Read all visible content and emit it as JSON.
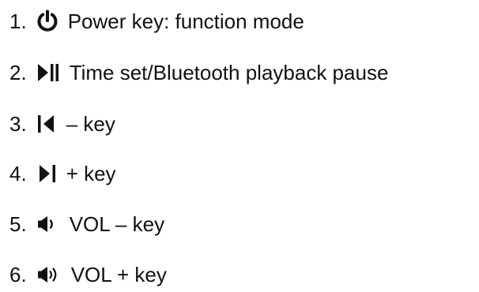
{
  "items": [
    {
      "number": "1.",
      "icon": "power-icon",
      "label": "Power key: function mode"
    },
    {
      "number": "2.",
      "icon": "play-pause-icon",
      "label": "Time set/Bluetooth playback pause"
    },
    {
      "number": "3.",
      "icon": "skip-previous-icon",
      "label": "– key"
    },
    {
      "number": "4.",
      "icon": "skip-next-icon",
      "label": "+ key"
    },
    {
      "number": "5.",
      "icon": "volume-low-icon",
      "label": "VOL – key"
    },
    {
      "number": "6.",
      "icon": "volume-high-icon",
      "label": "VOL + key"
    }
  ],
  "colors": {
    "text": "#111111",
    "icon": "#111111"
  }
}
